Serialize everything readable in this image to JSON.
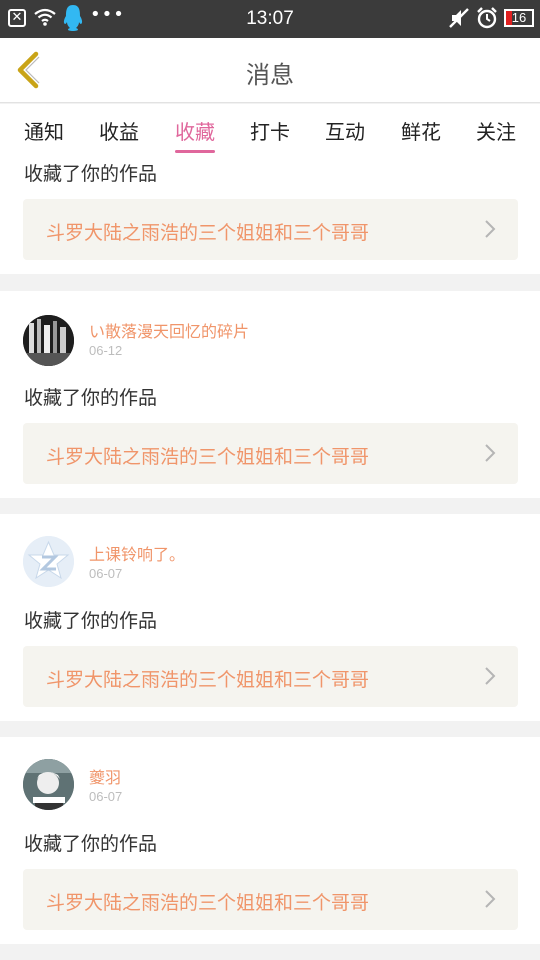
{
  "status_bar": {
    "time": "13:07",
    "battery": "16",
    "icons": [
      "close-icon",
      "wifi-icon",
      "qq-icon",
      "more-icon",
      "mute-icon",
      "alarm-icon",
      "battery-icon"
    ]
  },
  "header": {
    "title": "消息",
    "back_icon": "chevron-left-icon"
  },
  "tabs": [
    {
      "label": "通知"
    },
    {
      "label": "收益"
    },
    {
      "label": "收藏",
      "active": true
    },
    {
      "label": "打卡"
    },
    {
      "label": "互动"
    },
    {
      "label": "鲜花"
    },
    {
      "label": "关注"
    }
  ],
  "colors": {
    "accent": "#e0679c",
    "link": "#f0956a",
    "status_bar": "#3b3b3b"
  },
  "notifications": [
    {
      "message": "收藏了你的作品",
      "work_title": "斗罗大陆之雨浩的三个姐姐和三个哥哥"
    },
    {
      "username": "い散落漫天回忆的碎片",
      "date": "06-12",
      "message": "收藏了你的作品",
      "work_title": "斗罗大陆之雨浩的三个姐姐和三个哥哥"
    },
    {
      "username": "上课铃响了。",
      "date": "06-07",
      "message": "收藏了你的作品",
      "work_title": "斗罗大陆之雨浩的三个姐姐和三个哥哥"
    },
    {
      "username": "夔羽",
      "date": "06-07",
      "message": "收藏了你的作品",
      "work_title": "斗罗大陆之雨浩的三个姐姐和三个哥哥"
    }
  ]
}
